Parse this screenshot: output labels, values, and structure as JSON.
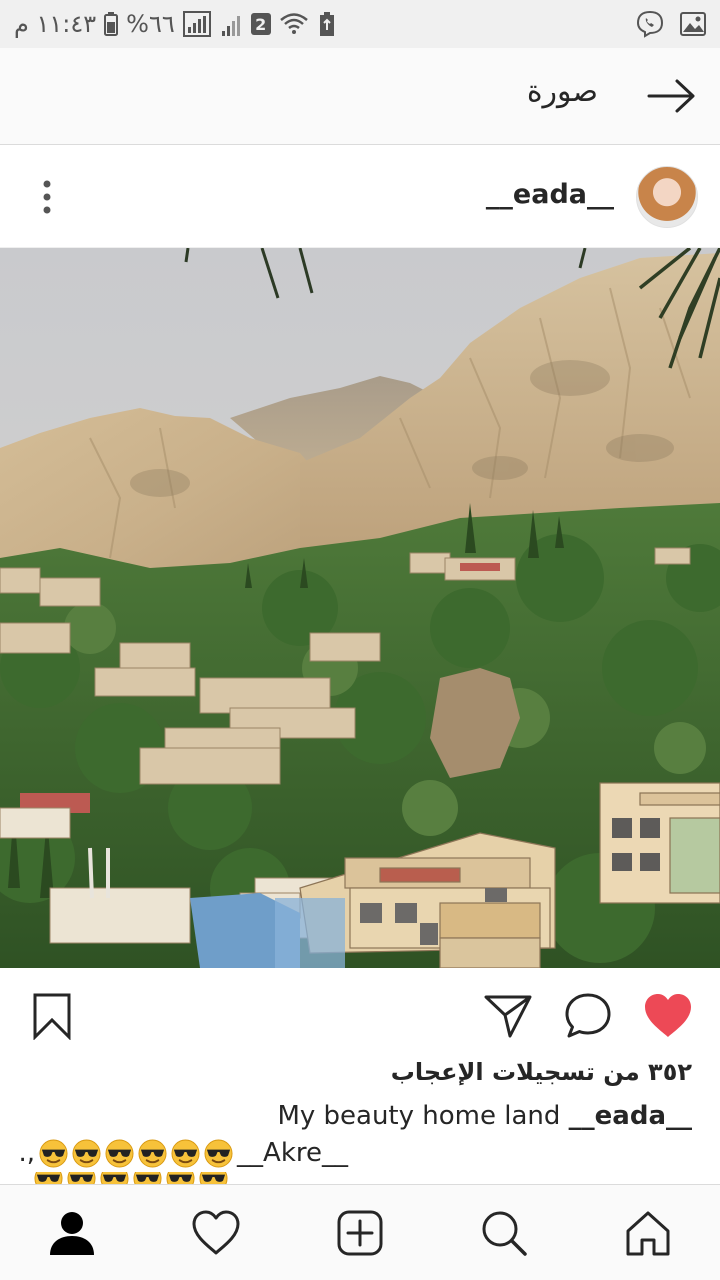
{
  "status_bar": {
    "time": "١١:٤٣ م",
    "battery": "%٦٦",
    "sim_slot": "2",
    "icons": [
      "battery-icon",
      "signal-icon",
      "wifi-icon",
      "storage-cleaner-icon",
      "viber-icon",
      "gallery-icon"
    ]
  },
  "header": {
    "title": "صورة",
    "back_icon": "arrow-right-icon"
  },
  "post": {
    "username": "__eada__",
    "more_icon": "vertical-dots-icon",
    "photo": "mountain-town-photo",
    "likes": "٣٥٢ من تسجيلات الإعجاب",
    "caption_user": "__eada__",
    "caption_text": "My beauty home land",
    "comment_text": "__Akre__",
    "comment_suffix": ".,",
    "emoji": "sunglasses-face-emoji",
    "emoji_count": 6
  },
  "actions": [
    "heart-icon",
    "comment-icon",
    "share-icon",
    "bookmark-icon"
  ],
  "colors": {
    "liked": "#ed4956",
    "text": "#262626",
    "divider": "#dbdbdb",
    "bar": "#fafafa",
    "status": "#f0f0f0"
  },
  "bottom_nav": [
    "home-icon",
    "search-icon",
    "new-post-icon",
    "activity-icon",
    "profile-icon"
  ]
}
